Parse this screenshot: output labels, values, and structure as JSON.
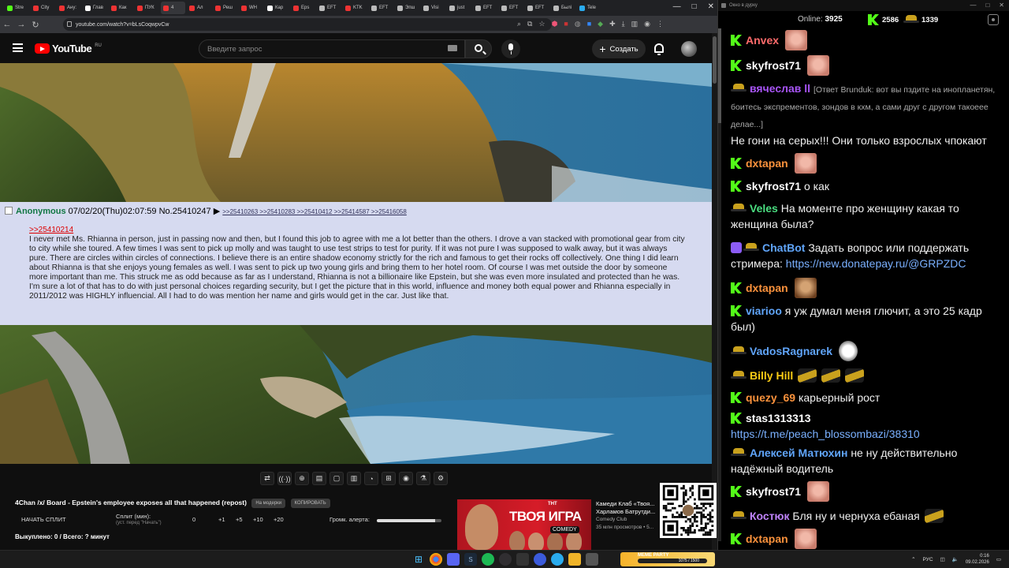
{
  "browser": {
    "tabs": [
      "Stre",
      "City",
      "Ану:",
      "Глав",
      "Как",
      "ПУК",
      "4",
      "Ал",
      "Реш",
      "WH",
      "Кар",
      "Eps",
      "EFT",
      "KTK",
      "EFT",
      "Эпш",
      "Visi",
      "just",
      "EFT",
      "EFT",
      "EFT",
      "Былі",
      "Tele"
    ],
    "url": "youtube.com/watch?v=bLsCoqwpvCw",
    "window_controls": [
      "—",
      "□",
      "✕"
    ]
  },
  "youtube": {
    "logo_text": "YouTube",
    "region": "RU",
    "search_placeholder": "Введите запрос",
    "create_label": "Создать"
  },
  "post": {
    "anon": "Anonymous",
    "header": "07/02/20(Thu)02:07:59 No.25410247 ▶",
    "replies": ">>25410263 >>25410283 >>25410412 >>25414587 >>25416058",
    "quote": ">>25410214",
    "body": "I never met Ms. Rhianna in person, just in passing now and then, but I found this job to agree with me a lot better than the others. I drove a van stacked with promotional gear from city to city while she toured. A few times I was sent to pick up molly and was taught to use test strips to test for purity. If it was not pure I was supposed to walk away, but it was always pure. There are circles within circles of connections. I believe there is an entire shadow economy strictly for the rich and famous to get their rocks off collectively. One thing I did learn about Rhianna is that she enjoys young females as well. I was sent to pick up two young girls and bring them to her hotel room. Of course I was met outside the door by someone more important than me. This struck me as odd because as far as I understand, Rhianna is not a billionaire like Epstein, but she was even more insulated and protected than he was. I'm sure a lot of that has to do with just personal choices regarding security, but I get the picture that in this world, influence and money both equal power and Rhianna especially in 2011/2012 was HIGHLY influencial. All I had to do was mention her name and girls would get in the car. Just like that."
  },
  "below": {
    "tools": [
      "⇄",
      "((·))",
      "⊕",
      "▤",
      "▢",
      "▥",
      "◔",
      "⊞",
      "◉",
      "⚗",
      "⚙"
    ],
    "video_title": "4Chan /x/ Board - Epstein's employee exposes all that happened (repost)",
    "pill1": "На модерки",
    "pill2": "КОПИРОВАТЬ",
    "split_start": "НАЧАТЬ СПЛИТ",
    "split_label": "Сплит (мин):",
    "split_sub": "(уст. перед \"Начать\")",
    "split_value": "0",
    "split_btns": [
      "+1",
      "+5",
      "+10",
      "+20"
    ],
    "volume_label": "Громк. алерта:",
    "volume_level": 0.9,
    "total": "Выкуплено: 0 / Всего: ? минут",
    "ad_title": "ТВОЯ ИГРА",
    "ad_comedy": "COMEDY",
    "ad_tnt": "ТНТ",
    "ad_meta_title": "Камеди Клаб «Твоя... Харламов Батрутди...",
    "ad_channel": "Comedy Club",
    "ad_views": "35 млн просмотров • 5..."
  },
  "chat": {
    "window_title": "Окно в дурку",
    "online_label": "Online:",
    "online_count": "3925",
    "kick_count": "2586",
    "points_count": "1339",
    "messages": [
      {
        "name": "Anvex",
        "color": "#ff6b6b",
        "badge": "kick",
        "text": "",
        "emote": "face1"
      },
      {
        "name": "skyfrost71",
        "color": "#ffffff",
        "badge": "kick",
        "text": "",
        "emote": "face1"
      },
      {
        "name": "вячеслав ll",
        "color": "#a855f7",
        "badge": "hat",
        "reply": "[Ответ Brunduk: вот вы пздите на инопланетян, боитесь экспрементов, зондов в кхм, а сами друг с другом такоеее делае...]",
        "text": "Не гони на серых!!! Они только взрослых чпокают"
      },
      {
        "name": "dxtapan",
        "color": "#fb923c",
        "badge": "kick",
        "text": "",
        "emote": "face1"
      },
      {
        "name": "skyfrost71",
        "color": "#ffffff",
        "badge": "kick",
        "text": "о как"
      },
      {
        "name": "Veles",
        "color": "#4ade80",
        "badge": "hat",
        "text": "На моменте про женщину какая то женщина была?"
      },
      {
        "name": "ChatBot",
        "color": "#60a5fa",
        "badge": "bot",
        "text": "Задать вопрос или поддержать стримера:",
        "link": "https://new.donatepay.ru/@GRPZDC"
      },
      {
        "name": "dxtapan",
        "color": "#fb923c",
        "badge": "kick",
        "text": "",
        "emote": "face2"
      },
      {
        "name": "viarioo",
        "color": "#60a5fa",
        "badge": "kick",
        "text": "я уж думал меня глючит, а это 25 кадр был)"
      },
      {
        "name": "VadosRagnarek",
        "color": "#60a5fa",
        "badge": "hat",
        "text": "",
        "emote": "troll"
      },
      {
        "name": "Billy Hill",
        "color": "#facc15",
        "badge": "hat",
        "text": "",
        "emote": "hat3"
      },
      {
        "name": "quezy_69",
        "color": "#fb923c",
        "badge": "kick",
        "text": "карьерный рост"
      },
      {
        "name": "stas1313313",
        "color": "#ffffff",
        "badge": "kick",
        "text": "",
        "link": "https://t.me/peach_blossombazi/38310"
      },
      {
        "name": "Алексей Матюхин",
        "color": "#60a5fa",
        "badge": "hat",
        "text": "не ну действительно надёжный водитель"
      },
      {
        "name": "skyfrost71",
        "color": "#ffffff",
        "badge": "kick",
        "text": "",
        "emote": "face1"
      },
      {
        "name": "Костюк",
        "color": "#c084fc",
        "badge": "hat",
        "text": "Бля ну и чернуха ебаная",
        "emote_after": "hatemo"
      },
      {
        "name": "dxtapan",
        "color": "#fb923c",
        "badge": "kick",
        "text": "",
        "emote": "face1"
      }
    ]
  },
  "taskbar": {
    "meme_label": "MEME PARTY",
    "meme_progress": "1075 / 1500",
    "lang": "РУС",
    "time": "0:16",
    "date": "09.02.2026"
  }
}
